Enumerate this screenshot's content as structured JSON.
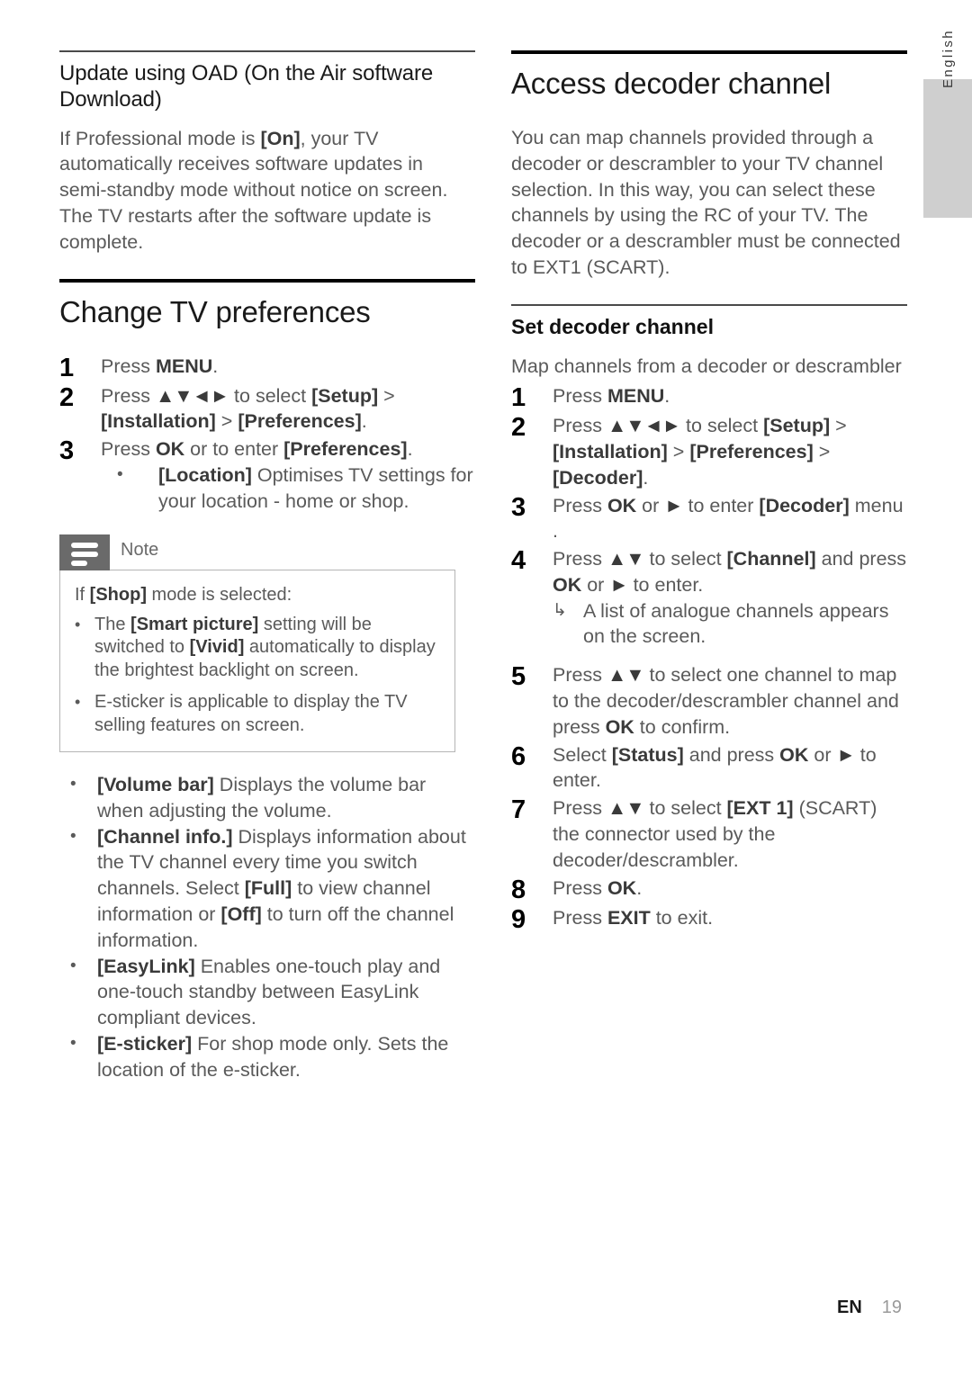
{
  "page": {
    "language_tab": "English",
    "footer": {
      "lang_code": "EN",
      "page_number": "19"
    }
  },
  "left_column": {
    "oad_section": {
      "title": "Update using OAD (On the Air software Download)",
      "paragraph_a": "If Professional mode is ",
      "paragraph_bold": "[On]",
      "paragraph_b": ", your TV automatically receives software updates in semi-standby mode without notice on screen. The TV restarts after the software update is complete."
    },
    "preferences_section": {
      "title": "Change TV preferences",
      "steps": [
        {
          "num": "1",
          "parts": [
            {
              "t": "Press ",
              "b": false
            },
            {
              "t": "MENU",
              "b": true
            },
            {
              "t": ".",
              "b": false
            }
          ]
        },
        {
          "num": "2",
          "parts": [
            {
              "t": "Press ",
              "b": false
            },
            {
              "t": "▲▼◄►",
              "b": true
            },
            {
              "t": " to select ",
              "b": false
            },
            {
              "t": "[Setup]",
              "b": true
            },
            {
              "t": " > ",
              "b": false
            },
            {
              "t": "[Installation]",
              "b": true
            },
            {
              "t": " > ",
              "b": false
            },
            {
              "t": "[Preferences]",
              "b": true
            },
            {
              "t": ".",
              "b": false
            }
          ]
        },
        {
          "num": "3",
          "parts": [
            {
              "t": "Press ",
              "b": false
            },
            {
              "t": "OK",
              "b": true
            },
            {
              "t": " or to enter ",
              "b": false
            },
            {
              "t": "[Preferences]",
              "b": true
            },
            {
              "t": ".",
              "b": false
            }
          ]
        }
      ],
      "location_bullet": {
        "bold": "[Location]",
        "text": " Optimises TV settings for your location - home or shop."
      },
      "bullets_after_note": [
        {
          "bold": "[Volume bar]",
          "text": " Displays the volume bar when adjusting the volume."
        },
        {
          "bold": "[Channel info.]",
          "text_a": " Displays information about the TV channel every time you switch channels. Select ",
          "bold_b": "[Full]",
          "text_b": " to view channel information or ",
          "bold_c": "[Off]",
          "text_c": " to turn off the channel information."
        },
        {
          "bold": "[EasyLink]",
          "text": " Enables one-touch play and one-touch standby between EasyLink compliant devices."
        },
        {
          "bold": "[E-sticker]",
          "text": " For shop mode only. Sets the location of the e-sticker."
        }
      ]
    },
    "note": {
      "label": "Note",
      "intro_a": "If ",
      "intro_bold": "[Shop]",
      "intro_b": " mode is selected:",
      "bullets": [
        {
          "a": "The ",
          "bold_a": "[Smart picture]",
          "b": " setting will be switched to ",
          "bold_b": "[Vivid]",
          "c": " automatically to display the brightest backlight on screen."
        },
        {
          "a": "E-sticker is applicable to display the TV selling features on screen.",
          "bold_a": "",
          "b": "",
          "bold_b": "",
          "c": ""
        }
      ]
    }
  },
  "right_column": {
    "decoder_section": {
      "title": "Access decoder channel",
      "paragraph": "You can map channels provided through a decoder or descrambler to your TV channel selection. In this way, you can select these channels by using the RC of your TV. The decoder or a descrambler must be connected to EXT1 (SCART)."
    },
    "set_decoder": {
      "title": "Set decoder channel",
      "intro": "Map channels from a decoder or descrambler",
      "steps": [
        {
          "num": "1",
          "parts": [
            {
              "t": "Press ",
              "b": false
            },
            {
              "t": "MENU",
              "b": true
            },
            {
              "t": ".",
              "b": false
            }
          ]
        },
        {
          "num": "2",
          "parts": [
            {
              "t": "Press ",
              "b": false
            },
            {
              "t": "▲▼◄►",
              "b": true
            },
            {
              "t": " to select ",
              "b": false
            },
            {
              "t": "[Setup]",
              "b": true
            },
            {
              "t": " > ",
              "b": false
            },
            {
              "t": "[Installation]",
              "b": true
            },
            {
              "t": " > ",
              "b": false
            },
            {
              "t": "[Preferences]",
              "b": true
            },
            {
              "t": " > ",
              "b": false
            },
            {
              "t": "[Decoder]",
              "b": true
            },
            {
              "t": ".",
              "b": false
            }
          ]
        },
        {
          "num": "3",
          "parts": [
            {
              "t": "Press ",
              "b": false
            },
            {
              "t": "OK",
              "b": true
            },
            {
              "t": " or ",
              "b": false
            },
            {
              "t": "►",
              "b": true
            },
            {
              "t": " to enter ",
              "b": false
            },
            {
              "t": "[Decoder]",
              "b": true
            },
            {
              "t": " menu",
              "b": false
            }
          ],
          "trailing_mark": "."
        },
        {
          "num": "4",
          "parts": [
            {
              "t": "Press ",
              "b": false
            },
            {
              "t": "▲▼",
              "b": true
            },
            {
              "t": " to select ",
              "b": false
            },
            {
              "t": "[Channel]",
              "b": true
            },
            {
              "t": " and press ",
              "b": false
            },
            {
              "t": "OK",
              "b": true
            },
            {
              "t": " or ",
              "b": false
            },
            {
              "t": "►",
              "b": true
            },
            {
              "t": " to enter.",
              "b": false
            }
          ],
          "result": "A list of analogue channels appears on the screen."
        },
        {
          "num": "5",
          "parts": [
            {
              "t": "Press ",
              "b": false
            },
            {
              "t": "▲▼",
              "b": true
            },
            {
              "t": " to select one channel to map to the decoder/descrambler channel and press ",
              "b": false
            },
            {
              "t": "OK",
              "b": true
            },
            {
              "t": " to confirm.",
              "b": false
            }
          ]
        },
        {
          "num": "6",
          "parts": [
            {
              "t": "Select ",
              "b": false
            },
            {
              "t": "[Status]",
              "b": true
            },
            {
              "t": " and press ",
              "b": false
            },
            {
              "t": "OK",
              "b": true
            },
            {
              "t": " or ",
              "b": false
            },
            {
              "t": "►",
              "b": true
            },
            {
              "t": " to enter.",
              "b": false
            }
          ]
        },
        {
          "num": "7",
          "parts": [
            {
              "t": "Press ",
              "b": false
            },
            {
              "t": "▲▼",
              "b": true
            },
            {
              "t": " to select ",
              "b": false
            },
            {
              "t": "[EXT 1]",
              "b": true
            },
            {
              "t": " (SCART) the connector used by the decoder/descrambler.",
              "b": false
            }
          ]
        },
        {
          "num": "8",
          "parts": [
            {
              "t": "Press ",
              "b": false
            },
            {
              "t": "OK",
              "b": true
            },
            {
              "t": ".",
              "b": false
            }
          ]
        },
        {
          "num": "9",
          "parts": [
            {
              "t": "Press ",
              "b": false
            },
            {
              "t": "EXIT",
              "b": true
            },
            {
              "t": " to exit.",
              "b": false
            }
          ]
        }
      ],
      "result_arrow_glyph": "↳"
    }
  },
  "glyphs": {
    "bullet_dot": "•",
    "note_bar_icon": "note-lines-icon"
  }
}
